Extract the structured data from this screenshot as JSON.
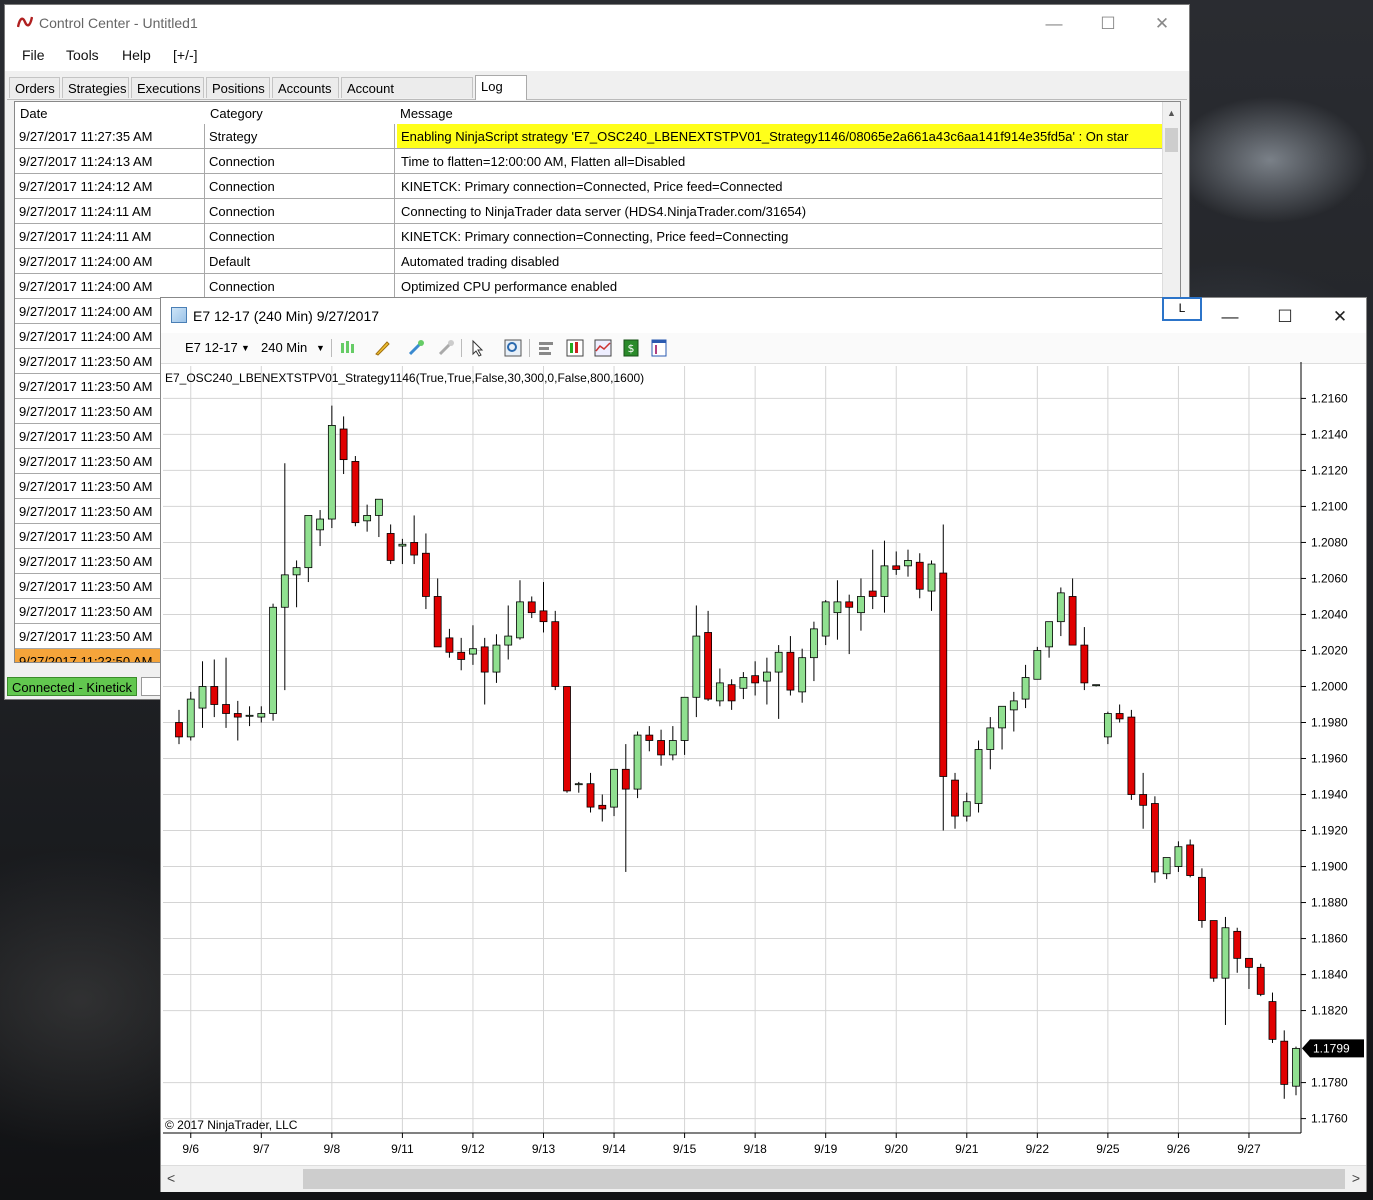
{
  "control_center": {
    "title": "Control Center - Untitled1",
    "menu": [
      "File",
      "Tools",
      "Help",
      "[+/-]"
    ],
    "tabs": [
      "Orders",
      "Strategies",
      "Executions",
      "Positions",
      "Accounts",
      "Account Performance",
      "Log"
    ],
    "active_tab": "Log",
    "log": {
      "columns": [
        "Date",
        "Category",
        "Message"
      ],
      "rows": [
        {
          "date": "9/27/2017 11:27:35 AM",
          "category": "Strategy",
          "message": "Enabling NinjaScript strategy 'E7_OSC240_LBENEXTSTPV01_Strategy1146/08065e2a661a43c6aa141f914e35fd5a' : On star",
          "highlight": true
        },
        {
          "date": "9/27/2017 11:24:13 AM",
          "category": "Connection",
          "message": "Time to flatten=12:00:00 AM, Flatten all=Disabled"
        },
        {
          "date": "9/27/2017 11:24:12 AM",
          "category": "Connection",
          "message": "KINETCK: Primary connection=Connected, Price feed=Connected"
        },
        {
          "date": "9/27/2017 11:24:11 AM",
          "category": "Connection",
          "message": "Connecting to NinjaTrader data server (HDS4.NinjaTrader.com/31654)"
        },
        {
          "date": "9/27/2017 11:24:11 AM",
          "category": "Connection",
          "message": "KINETCK: Primary connection=Connecting, Price feed=Connecting"
        },
        {
          "date": "9/27/2017 11:24:00 AM",
          "category": "Default",
          "message": "Automated trading disabled"
        },
        {
          "date": "9/27/2017 11:24:00 AM",
          "category": "Connection",
          "message": "Optimized CPU performance enabled"
        },
        {
          "date": "9/27/2017 11:24:00 AM",
          "category": "",
          "message": ""
        },
        {
          "date": "9/27/2017 11:24:00 AM",
          "category": "",
          "message": ""
        },
        {
          "date": "9/27/2017 11:23:50 AM",
          "category": "",
          "message": ""
        },
        {
          "date": "9/27/2017 11:23:50 AM",
          "category": "",
          "message": ""
        },
        {
          "date": "9/27/2017 11:23:50 AM",
          "category": "",
          "message": ""
        },
        {
          "date": "9/27/2017 11:23:50 AM",
          "category": "",
          "message": ""
        },
        {
          "date": "9/27/2017 11:23:50 AM",
          "category": "",
          "message": ""
        },
        {
          "date": "9/27/2017 11:23:50 AM",
          "category": "",
          "message": ""
        },
        {
          "date": "9/27/2017 11:23:50 AM",
          "category": "",
          "message": ""
        },
        {
          "date": "9/27/2017 11:23:50 AM",
          "category": "",
          "message": ""
        },
        {
          "date": "9/27/2017 11:23:50 AM",
          "category": "",
          "message": ""
        },
        {
          "date": "9/27/2017 11:23:50 AM",
          "category": "",
          "message": ""
        },
        {
          "date": "9/27/2017 11:23:50 AM",
          "category": "",
          "message": ""
        },
        {
          "date": "9/27/2017 11:23:50 AM",
          "category": "",
          "message": ""
        },
        {
          "date": "9/27/2017 11:23:50 AM",
          "category": "",
          "message": "",
          "selected": true
        }
      ]
    },
    "status": "Connected - Kinetick",
    "colors": {
      "highlight": "#ffff1a",
      "selected_row": "#f5a43a",
      "connected": "#62c74f"
    }
  },
  "chart_window": {
    "title": "E7 12-17 (240 Min)  9/27/2017",
    "l_button": "L",
    "toolbar": {
      "instrument": "E7 12-17",
      "interval": "240 Min"
    },
    "strategy_label": "E7_OSC240_LBENEXTSTPV01_Strategy1146(True,True,False,30,300,0,False,800,1600)",
    "copyright": "© 2017 NinjaTrader, LLC",
    "colors": {
      "up": "#90e090",
      "down": "#e00000",
      "wick": "#000000",
      "grid": "#d4d4d4"
    }
  },
  "chart_data": {
    "type": "candlestick",
    "instrument": "E7 12-17",
    "interval": "240 Min",
    "x_labels": [
      "9/6",
      "9/7",
      "9/8",
      "9/11",
      "9/12",
      "9/13",
      "9/14",
      "9/15",
      "9/18",
      "9/19",
      "9/20",
      "9/21",
      "9/22",
      "9/25",
      "9/26",
      "9/27"
    ],
    "y_ticks": [
      "1.2160",
      "1.2140",
      "1.2120",
      "1.2100",
      "1.2080",
      "1.2060",
      "1.2040",
      "1.2020",
      "1.2000",
      "1.1980",
      "1.1960",
      "1.1940",
      "1.1920",
      "1.1900",
      "1.1880",
      "1.1860",
      "1.1840",
      "1.1820",
      "1.1780",
      "1.1760"
    ],
    "ylim": [
      1.1752,
      1.2178
    ],
    "last_price": "1.1799",
    "candles": [
      [
        1.198,
        1.1987,
        1.1968,
        1.1972
      ],
      [
        1.1972,
        1.1997,
        1.197,
        1.1993
      ],
      [
        1.1988,
        1.2014,
        1.1977,
        1.2
      ],
      [
        1.2,
        1.2015,
        1.1983,
        1.199
      ],
      [
        1.199,
        1.2016,
        1.1977,
        1.1985
      ],
      [
        1.1985,
        1.1992,
        1.197,
        1.1983
      ],
      [
        1.1984,
        1.1989,
        1.1978,
        1.1984
      ],
      [
        1.1983,
        1.1989,
        1.198,
        1.1985
      ],
      [
        1.1985,
        1.2046,
        1.1981,
        1.2044
      ],
      [
        1.2044,
        1.2124,
        1.1998,
        1.2062
      ],
      [
        1.2062,
        1.207,
        1.2044,
        1.2066
      ],
      [
        1.2066,
        1.2095,
        1.2058,
        1.2095
      ],
      [
        1.2087,
        1.2098,
        1.2078,
        1.2093
      ],
      [
        1.2093,
        1.2156,
        1.2088,
        1.2145
      ],
      [
        1.2143,
        1.215,
        1.2118,
        1.2126
      ],
      [
        1.2125,
        1.2128,
        1.2089,
        1.2091
      ],
      [
        1.2092,
        1.2101,
        1.2086,
        1.2095
      ],
      [
        1.2095,
        1.2103,
        1.2083,
        1.2104
      ],
      [
        1.2085,
        1.209,
        1.2068,
        1.207
      ],
      [
        1.2078,
        1.2082,
        1.2068,
        1.2079
      ],
      [
        1.208,
        1.2095,
        1.2068,
        1.2073
      ],
      [
        1.2074,
        1.2085,
        1.2043,
        1.205
      ],
      [
        1.205,
        1.206,
        1.2022,
        1.2022
      ],
      [
        1.2027,
        1.2032,
        1.2016,
        1.2019
      ],
      [
        1.2019,
        1.2027,
        1.2009,
        1.2015
      ],
      [
        1.2018,
        1.2034,
        1.2012,
        1.2021
      ],
      [
        1.2022,
        1.2027,
        1.199,
        1.2008
      ],
      [
        1.2008,
        1.2029,
        1.2002,
        1.2023
      ],
      [
        1.2023,
        1.2045,
        1.2015,
        1.2028
      ],
      [
        1.2027,
        1.2059,
        1.2026,
        1.2047
      ],
      [
        1.2047,
        1.205,
        1.2038,
        1.2041
      ],
      [
        1.2042,
        1.2058,
        1.203,
        1.2036
      ],
      [
        1.2036,
        1.2042,
        1.1998,
        1.2
      ],
      [
        1.2,
        1.2,
        1.1941,
        1.1942
      ],
      [
        1.1946,
        1.1947,
        1.1941,
        1.1946
      ],
      [
        1.1946,
        1.1952,
        1.193,
        1.1933
      ],
      [
        1.1934,
        1.194,
        1.1925,
        1.1932
      ],
      [
        1.1933,
        1.1953,
        1.1928,
        1.1954
      ],
      [
        1.1954,
        1.1968,
        1.1897,
        1.1943
      ],
      [
        1.1943,
        1.1975,
        1.1938,
        1.1973
      ],
      [
        1.1973,
        1.1978,
        1.1964,
        1.197
      ],
      [
        1.197,
        1.1976,
        1.1956,
        1.1962
      ],
      [
        1.1962,
        1.1978,
        1.1959,
        1.197
      ],
      [
        1.197,
        1.1993,
        1.1962,
        1.1994
      ],
      [
        1.1994,
        1.2045,
        1.1983,
        1.2028
      ],
      [
        1.203,
        1.2042,
        1.1992,
        1.1993
      ],
      [
        1.1992,
        1.201,
        1.1989,
        1.2002
      ],
      [
        1.2001,
        1.2004,
        1.1987,
        1.1992
      ],
      [
        1.1999,
        1.2008,
        1.1993,
        1.2005
      ],
      [
        1.2006,
        1.2014,
        1.1995,
        1.2002
      ],
      [
        1.2003,
        1.2016,
        1.199,
        1.2008
      ],
      [
        1.2008,
        1.2023,
        1.1982,
        1.2019
      ],
      [
        1.2019,
        1.2028,
        1.1995,
        1.1998
      ],
      [
        1.1997,
        1.2021,
        1.1991,
        1.2016
      ],
      [
        1.2016,
        1.2036,
        1.2003,
        1.2032
      ],
      [
        1.2028,
        1.2048,
        1.2023,
        1.2047
      ],
      [
        1.2041,
        1.2059,
        1.2026,
        1.2047
      ],
      [
        1.2047,
        1.2051,
        1.2018,
        1.2044
      ],
      [
        1.2041,
        1.206,
        1.2031,
        1.205
      ],
      [
        1.2053,
        1.2076,
        1.2043,
        1.205
      ],
      [
        1.205,
        1.2081,
        1.2041,
        1.2067
      ],
      [
        1.2067,
        1.2075,
        1.2062,
        1.2065
      ],
      [
        1.2067,
        1.2076,
        1.2061,
        1.207
      ],
      [
        1.2069,
        1.2074,
        1.2049,
        1.2054
      ],
      [
        1.2053,
        1.207,
        1.2042,
        1.2068
      ],
      [
        1.2063,
        1.209,
        1.192,
        1.195
      ],
      [
        1.1948,
        1.1952,
        1.1921,
        1.1928
      ],
      [
        1.1928,
        1.1941,
        1.1925,
        1.1936
      ],
      [
        1.1935,
        1.197,
        1.193,
        1.1965
      ],
      [
        1.1965,
        1.1983,
        1.1954,
        1.1977
      ],
      [
        1.1977,
        1.1986,
        1.1965,
        1.1989
      ],
      [
        1.1987,
        1.1997,
        1.1975,
        1.1992
      ],
      [
        1.1993,
        1.2012,
        1.1988,
        1.2005
      ],
      [
        1.2004,
        1.2022,
        1.2005,
        1.202
      ],
      [
        1.2022,
        1.2033,
        1.2016,
        1.2036
      ],
      [
        1.2036,
        1.2055,
        1.2028,
        1.2052
      ],
      [
        1.205,
        1.206,
        1.2031,
        1.2023
      ],
      [
        1.2023,
        1.2033,
        1.1998,
        1.2002
      ],
      [
        1.2001,
        1.2001,
        1.2,
        1.2001
      ],
      [
        1.1972,
        1.1986,
        1.1968,
        1.1985
      ],
      [
        1.1985,
        1.199,
        1.198,
        1.1982
      ],
      [
        1.1983,
        1.1987,
        1.1937,
        1.194
      ],
      [
        1.194,
        1.1952,
        1.1921,
        1.1934
      ],
      [
        1.1935,
        1.1939,
        1.1891,
        1.1897
      ],
      [
        1.1896,
        1.1905,
        1.1893,
        1.1905
      ],
      [
        1.19,
        1.1914,
        1.1897,
        1.1911
      ],
      [
        1.1912,
        1.1915,
        1.1894,
        1.1895
      ],
      [
        1.1894,
        1.1899,
        1.1866,
        1.187
      ],
      [
        1.187,
        1.1866,
        1.1836,
        1.1838
      ],
      [
        1.1838,
        1.1872,
        1.1812,
        1.1866
      ],
      [
        1.1864,
        1.1866,
        1.1841,
        1.1849
      ],
      [
        1.1849,
        1.1849,
        1.1832,
        1.1844
      ],
      [
        1.1844,
        1.1846,
        1.1828,
        1.1829
      ],
      [
        1.1825,
        1.183,
        1.1802,
        1.1804
      ],
      [
        1.1803,
        1.1809,
        1.1771,
        1.1779
      ],
      [
        1.1778,
        1.18,
        1.1773,
        1.1799
      ]
    ]
  }
}
